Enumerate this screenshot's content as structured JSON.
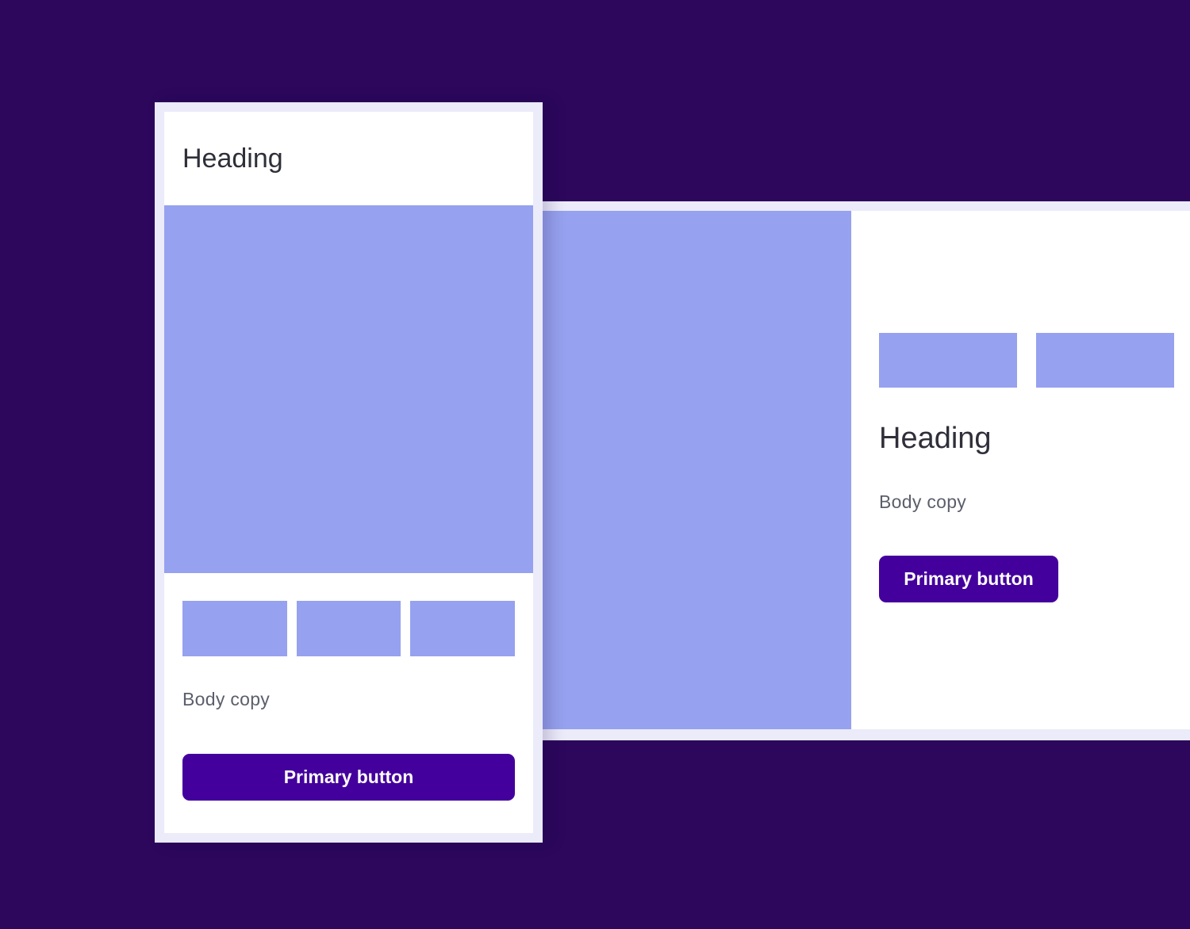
{
  "colors": {
    "background": "#2c075c",
    "frame": "#ebebfa",
    "surface": "#ffffff",
    "placeholder": "#96a1ef",
    "primary": "#43009c",
    "heading_text": "#2f2f3a",
    "body_text": "#5b5f6b"
  },
  "tall_card": {
    "heading": "Heading",
    "body": "Body copy",
    "button_label": "Primary button"
  },
  "wide_card": {
    "heading": "Heading",
    "body": "Body copy",
    "button_label": "Primary button"
  }
}
